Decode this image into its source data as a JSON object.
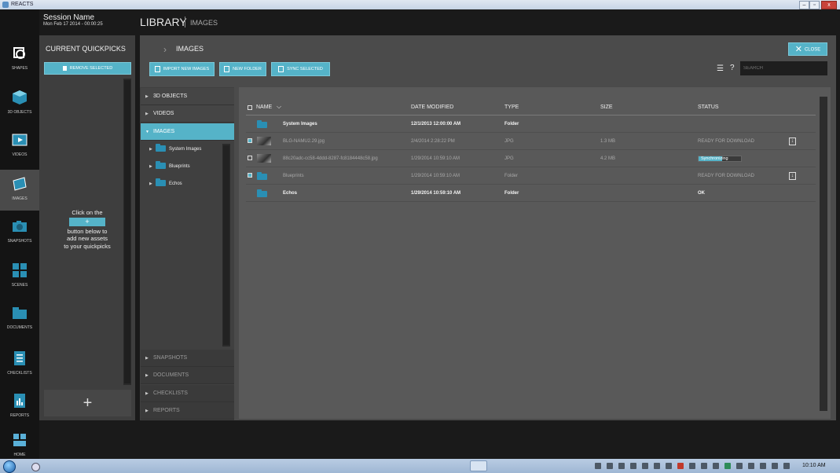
{
  "window": {
    "title": "REACTS"
  },
  "session": {
    "name": "Session Name",
    "date": "Mon Feb 17 2014 - 00:00:25"
  },
  "header": {
    "section": "LIBRARY",
    "subsection": "IMAGES"
  },
  "left_nav": [
    {
      "label": "SHAPES",
      "icon": "shapes-icon"
    },
    {
      "label": "3D OBJECTS",
      "icon": "cube-icon"
    },
    {
      "label": "VIDEOS",
      "icon": "film-icon"
    },
    {
      "label": "IMAGES",
      "icon": "image-icon",
      "active": true
    },
    {
      "label": "SNAPSHOTS",
      "icon": "camera-icon"
    },
    {
      "label": "SCENES",
      "icon": "scenes-icon"
    },
    {
      "label": "DOCUMENTS",
      "icon": "folder-icon"
    },
    {
      "label": "CHECKLISTS",
      "icon": "checklist-icon"
    },
    {
      "label": "REPORTS",
      "icon": "report-icon"
    },
    {
      "label": "HOME",
      "icon": "home-icon"
    }
  ],
  "quickpicks": {
    "title": "CURRENT QUICKPICKS",
    "remove_label": "REMOVE SELECTED",
    "hint_line1": "Click on the",
    "hint_plus": "+",
    "hint_line2": "button below to",
    "hint_line3": "add new assets",
    "hint_line4": "to your quickpicks",
    "add_label": "+"
  },
  "library": {
    "title": "IMAGES",
    "toolbar": {
      "import": "IMPORT NEW IMAGES",
      "new_folder": "NEW FOLDER",
      "sync": "SYNC SELECTED"
    },
    "close_label": "CLOSE",
    "search_placeholder": "SEARCH"
  },
  "tree": {
    "top_categories": [
      "3D OBJECTS",
      "VIDEOS",
      "IMAGES"
    ],
    "image_folders": [
      "System Images",
      "Blueprints",
      "Echos"
    ],
    "bottom_categories": [
      "SNAPSHOTS",
      "DOCUMENTS",
      "CHECKLISTS",
      "REPORTS"
    ]
  },
  "file_list": {
    "columns": [
      "NAME",
      "DATE MODIFIED",
      "TYPE",
      "SIZE",
      "STATUS"
    ],
    "rows": [
      {
        "name": "System Images",
        "date": "12/1/2013 12:00:00 AM",
        "type": "Folder",
        "size": "",
        "status": ""
      },
      {
        "name": "BLG-NAMU2.29.jpg",
        "date": "2/4/2014 2:28:22 PM",
        "type": "JPG",
        "size": "1.3 MB",
        "status": "READY FOR DOWNLOAD"
      },
      {
        "name": "88c20adc-cc58-4ddd-8287-fc8184448c58.jpg",
        "date": "1/29/2014 10:59:10 AM",
        "type": "JPG",
        "size": "4.2 MB",
        "status": "Synchronizing"
      },
      {
        "name": "Blueprints",
        "date": "1/29/2014 10:59:10 AM",
        "type": "Folder",
        "size": "",
        "status": "READY FOR DOWNLOAD"
      },
      {
        "name": "Echos",
        "date": "1/29/2014 10:59:10 AM",
        "type": "Folder",
        "size": "",
        "status": "OK"
      }
    ],
    "sync_progress": 0.55
  },
  "taskbar": {
    "clock": "10:10 AM"
  },
  "colors": {
    "accent": "#55b3c8",
    "folder": "#2a8fb4"
  }
}
